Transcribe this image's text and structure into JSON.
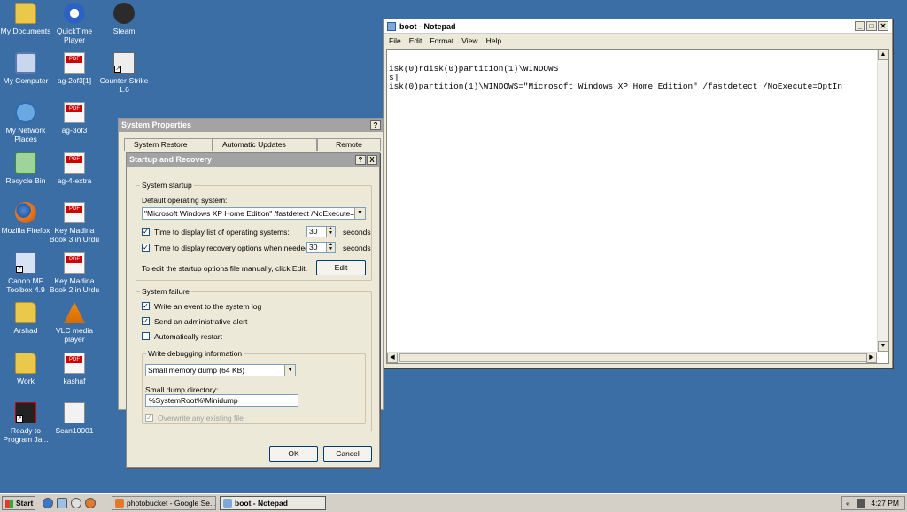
{
  "desktop": {
    "icons": [
      {
        "label": "My Documents"
      },
      {
        "label": "My Computer"
      },
      {
        "label": "My Network Places"
      },
      {
        "label": "Recycle Bin"
      },
      {
        "label": "Mozilla Firefox"
      },
      {
        "label": "Canon MF Toolbox 4.9"
      },
      {
        "label": "Arshad"
      },
      {
        "label": "Work"
      },
      {
        "label": "Ready to Program Ja..."
      },
      {
        "label": "QuickTime Player"
      },
      {
        "label": "ag-2of3[1]"
      },
      {
        "label": "ag-3of3"
      },
      {
        "label": "ag-4-extra"
      },
      {
        "label": "Key Madina Book 3 in Urdu"
      },
      {
        "label": "Key Madina Book 2 in Urdu"
      },
      {
        "label": "VLC media player"
      },
      {
        "label": "kashaf"
      },
      {
        "label": "Scan10001"
      },
      {
        "label": "Steam"
      },
      {
        "label": "Counter-Strike 1.6"
      }
    ]
  },
  "notepad": {
    "title": "boot - Notepad",
    "menu": [
      "File",
      "Edit",
      "Format",
      "View",
      "Help"
    ],
    "lines": [
      "",
      "isk(0)rdisk(0)partition(1)\\WINDOWS",
      "s]",
      "isk(0)partition(1)\\WINDOWS=\"Microsoft Windows XP Home Edition\" /fastdetect /NoExecute=OptIn"
    ]
  },
  "system_properties": {
    "title": "System Properties",
    "tabs": [
      "System Restore",
      "Automatic Updates",
      "Remote"
    ],
    "help": "?"
  },
  "startup_recovery": {
    "title": "Startup and Recovery",
    "help": "?",
    "close": "X",
    "system_startup": {
      "legend": "System startup",
      "default_os_label": "Default operating system:",
      "default_os_value": "\"Microsoft Windows XP Home Edition\" /fastdetect /NoExecute=Opt",
      "display_list_label": "Time to display list of operating systems:",
      "display_list_value": "30",
      "display_list_checked": true,
      "recovery_label": "Time to display recovery options when needed:",
      "recovery_value": "30",
      "recovery_checked": true,
      "seconds": "seconds",
      "edit_hint": "To edit the startup options file manually, click Edit.",
      "edit_button": "Edit"
    },
    "system_failure": {
      "legend": "System failure",
      "write_event": "Write an event to the system log",
      "write_event_checked": true,
      "send_alert": "Send an administrative alert",
      "send_alert_checked": true,
      "auto_restart": "Automatically restart",
      "auto_restart_checked": false,
      "debug_legend": "Write debugging information",
      "dump_type": "Small memory dump (64 KB)",
      "dump_dir_label": "Small dump directory:",
      "dump_dir_value": "%SystemRoot%\\Minidump",
      "overwrite": "Overwrite any existing file",
      "overwrite_checked": true
    },
    "ok_button": "OK",
    "cancel_button": "Cancel"
  },
  "taskbar": {
    "start": "Start",
    "tasks": [
      {
        "label": "photobucket - Google Se...",
        "active": false
      },
      {
        "label": "boot - Notepad",
        "active": true
      }
    ],
    "tray_chevron": "«",
    "clock": "4:27 PM"
  },
  "colors": {
    "desktop": "#3a6ea5",
    "title_inactive": "#a3a3a3"
  }
}
